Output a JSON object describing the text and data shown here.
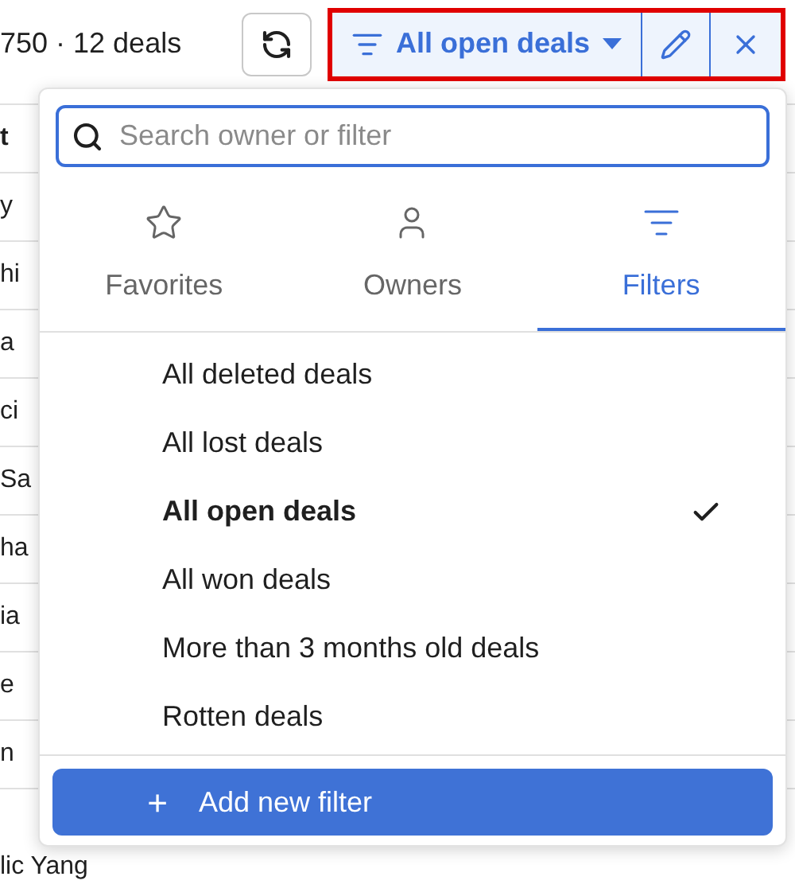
{
  "summary": "750 · 12 deals",
  "filter_bar": {
    "label": "All open deals"
  },
  "table": {
    "header": "t",
    "rows": [
      "y",
      "hi",
      "a",
      "ci",
      "Sa",
      "ha",
      "ia",
      "e",
      "n"
    ],
    "last_row": "lic Yang"
  },
  "popup": {
    "search": {
      "placeholder": "Search owner or filter"
    },
    "tabs": [
      {
        "label": "Favorites",
        "kind": "star",
        "selected": false
      },
      {
        "label": "Owners",
        "kind": "person",
        "selected": false
      },
      {
        "label": "Filters",
        "kind": "filter",
        "selected": true
      }
    ],
    "filters": [
      {
        "label": "All deleted deals",
        "selected": false
      },
      {
        "label": "All lost deals",
        "selected": false
      },
      {
        "label": "All open deals",
        "selected": true
      },
      {
        "label": "All won deals",
        "selected": false
      },
      {
        "label": "More than 3 months old deals",
        "selected": false
      },
      {
        "label": "Rotten deals",
        "selected": false
      }
    ],
    "add_button": {
      "symbol": "+",
      "label": "Add new filter"
    }
  }
}
